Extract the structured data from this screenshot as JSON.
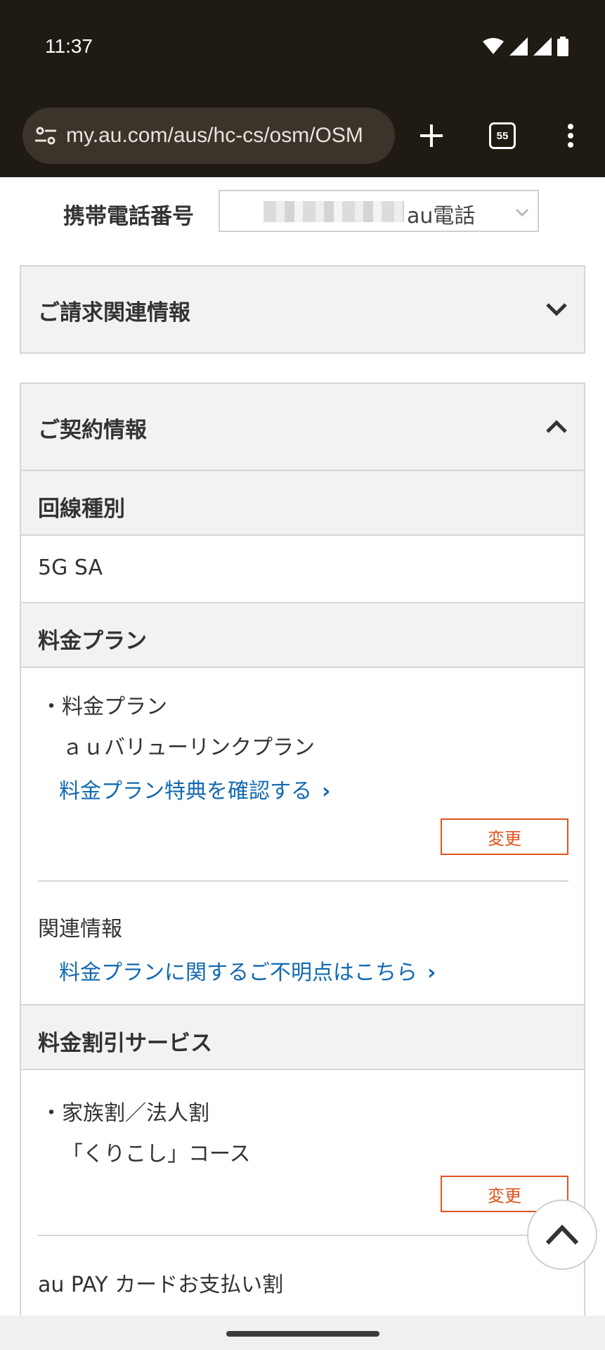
{
  "status_bar": {
    "time": "11:37"
  },
  "browser": {
    "url": "my.au.com/aus/hc-cs/osm/OSM",
    "tab_count": "55"
  },
  "phone": {
    "label": "携帯電話番号",
    "select_value": "au電話"
  },
  "billing_section": {
    "title": "ご請求関連情報"
  },
  "contract_section": {
    "title": "ご契約情報",
    "line_type": {
      "header": "回線種別",
      "value": "5G SA"
    },
    "plan": {
      "header": "料金プラン",
      "item_label": "・料金プラン",
      "item_value": "ａｕバリューリンクプラン",
      "benefit_link": "料金プラン特典を確認する",
      "change_button": "変更",
      "related_label": "関連情報",
      "related_link": "料金プランに関するご不明点はこちら"
    },
    "discount": {
      "header": "料金割引サービス",
      "item_label": "・家族割／法人割",
      "item_value": "「くりこし」コース",
      "change_button": "変更",
      "next_item": "au PAY カードお支払い割"
    }
  }
}
